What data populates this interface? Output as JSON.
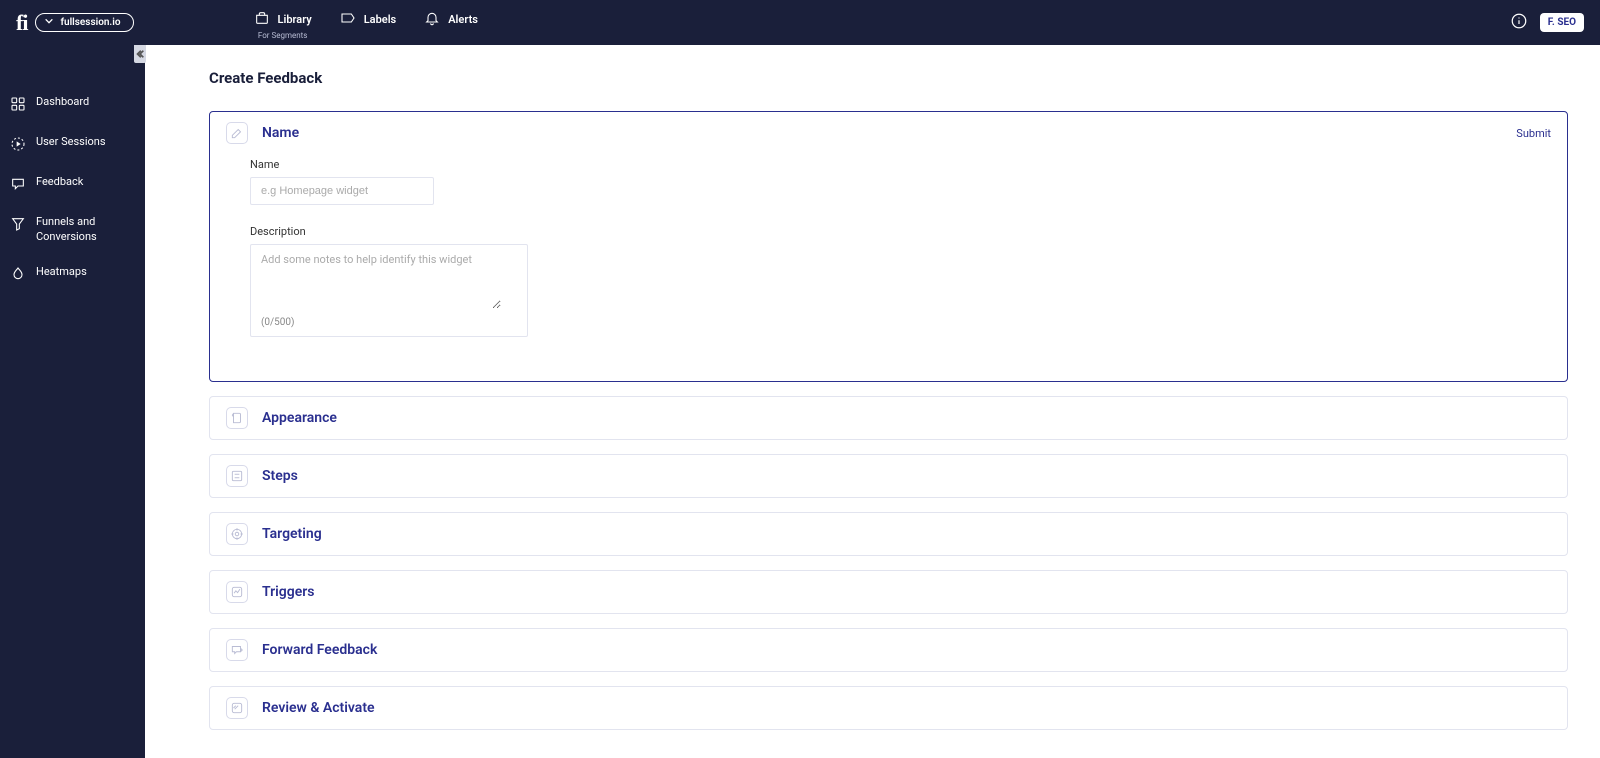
{
  "workspace": {
    "name": "fullsession.io"
  },
  "topnav": {
    "library": {
      "label": "Library",
      "sublabel": "For Segments"
    },
    "labels": {
      "label": "Labels"
    },
    "alerts": {
      "label": "Alerts"
    }
  },
  "user": {
    "badge": "F. SEO"
  },
  "sidebar": {
    "items": [
      {
        "label": "Dashboard"
      },
      {
        "label": "User Sessions"
      },
      {
        "label": "Feedback"
      },
      {
        "label": "Funnels and Conversions"
      },
      {
        "label": "Heatmaps"
      }
    ]
  },
  "page": {
    "title": "Create Feedback"
  },
  "sections": {
    "name": {
      "title": "Name",
      "action": "Submit"
    },
    "appearance": {
      "title": "Appearance"
    },
    "steps": {
      "title": "Steps"
    },
    "targeting": {
      "title": "Targeting"
    },
    "triggers": {
      "title": "Triggers"
    },
    "forward": {
      "title": "Forward Feedback"
    },
    "review": {
      "title": "Review & Activate"
    }
  },
  "form": {
    "name_label": "Name",
    "name_placeholder": "e.g Homepage widget",
    "desc_label": "Description",
    "desc_placeholder": "Add some notes to help identify this widget",
    "desc_counter": "(0/500)"
  }
}
